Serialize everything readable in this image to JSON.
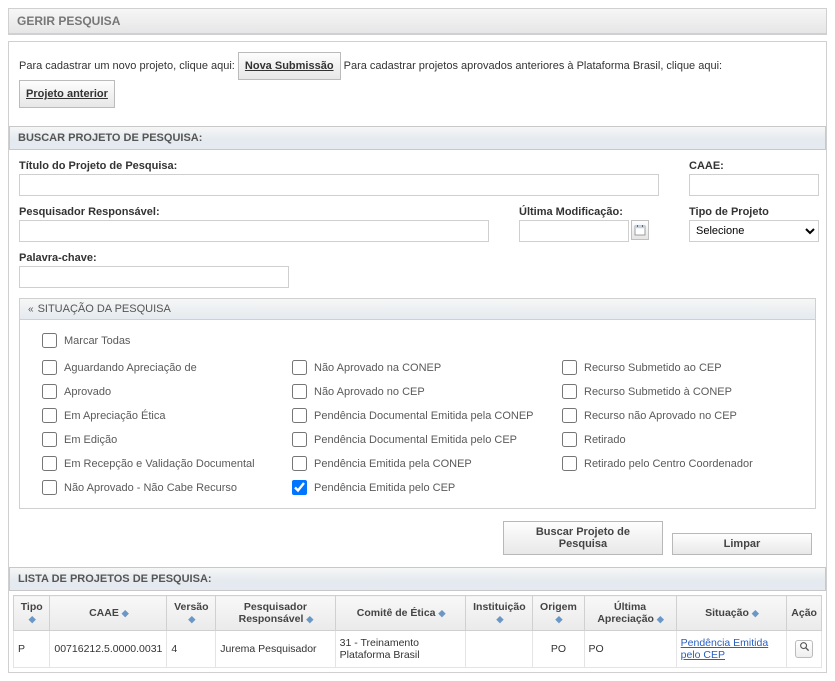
{
  "header": {
    "title": "GERIR PESQUISA"
  },
  "intro": {
    "text1": "Para cadastrar um novo projeto, clique aqui:",
    "btn1": "Nova Submissão",
    "text2": "Para cadastrar projetos aprovados anteriores à Plataforma Brasil, clique aqui:",
    "btn2": "Projeto anterior"
  },
  "search": {
    "heading": "BUSCAR PROJETO DE PESQUISA:",
    "title_label": "Título do Projeto de Pesquisa:",
    "title_value": "",
    "caae_label": "CAAE:",
    "caae_value": "",
    "pr_label": "Pesquisador Responsável:",
    "pr_value": "",
    "um_label": "Última Modificação:",
    "um_value": "",
    "tipo_label": "Tipo de Projeto",
    "tipo_selected": "Selecione",
    "pc_label": "Palavra-chave:",
    "pc_value": ""
  },
  "situacao": {
    "heading": "SITUAÇÃO DA PESQUISA",
    "marcar_todas": "Marcar Todas",
    "col1": [
      "Aguardando Apreciação de",
      "Aprovado",
      "Em Apreciação Ética",
      "Em Edição",
      "Em Recepção e Validação Documental",
      "Não Aprovado - Não Cabe Recurso"
    ],
    "col2": [
      "Não Aprovado na CONEP",
      "Não Aprovado no CEP",
      "Pendência Documental Emitida pela CONEP",
      "Pendência Documental Emitida pelo CEP",
      "Pendência Emitida pela CONEP",
      "Pendência Emitida pelo CEP"
    ],
    "col3": [
      "Recurso Submetido ao CEP",
      "Recurso Submetido à CONEP",
      "Recurso não Aprovado no CEP",
      "Retirado",
      "Retirado pelo Centro Coordenador"
    ]
  },
  "buttons": {
    "buscar": "Buscar Projeto de Pesquisa",
    "limpar": "Limpar"
  },
  "list": {
    "heading": "LISTA DE PROJETOS DE PESQUISA:",
    "cols": {
      "tipo": "Tipo",
      "caae": "CAAE",
      "versao": "Versão",
      "pr": "Pesquisador Responsável",
      "comite": "Comitê de Ética",
      "inst": "Instituição",
      "origem": "Origem",
      "ua": "Última Apreciação",
      "sit": "Situação",
      "acao": "Ação"
    },
    "row": {
      "tipo": "P",
      "caae": "00716212.5.0000.0031",
      "versao": "4",
      "pr": "Jurema Pesquisador",
      "comite": "31 - Treinamento Plataforma Brasil",
      "inst": "",
      "origem": "PO",
      "ua": "PO",
      "sit": "Pendência Emitida pelo CEP"
    }
  }
}
